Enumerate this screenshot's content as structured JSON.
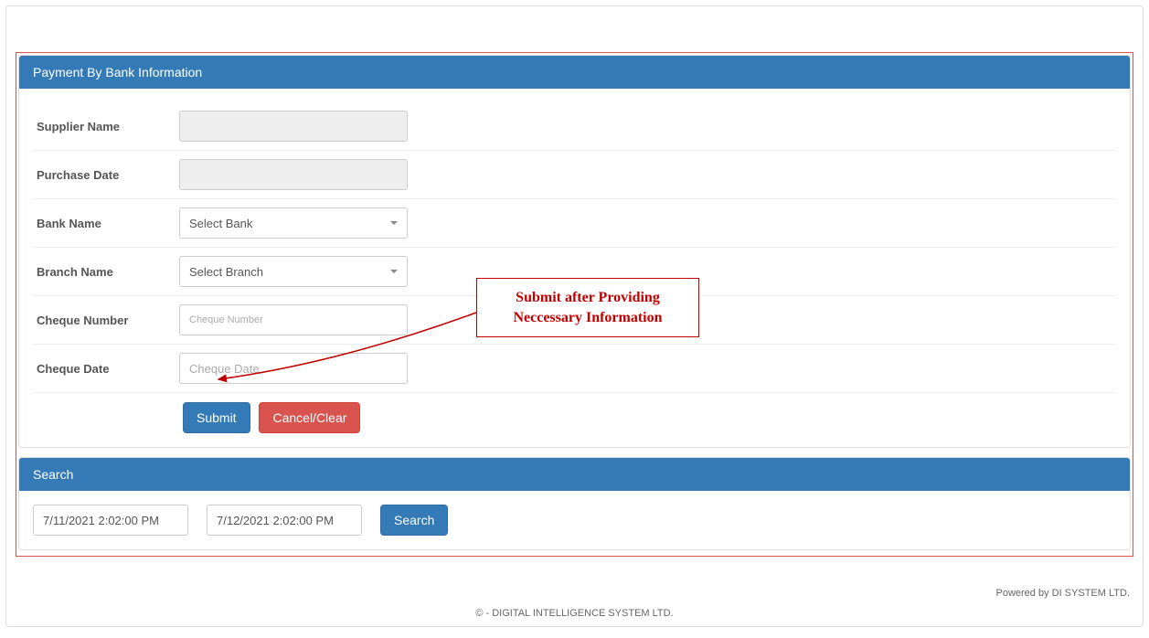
{
  "panel1": {
    "title": "Payment By Bank Information",
    "fields": {
      "supplier_name": {
        "label": "Supplier Name",
        "value": ""
      },
      "purchase_date": {
        "label": "Purchase Date",
        "value": ""
      },
      "bank_name": {
        "label": "Bank Name",
        "selected": "Select Bank"
      },
      "branch_name": {
        "label": "Branch Name",
        "selected": "Select Branch"
      },
      "cheque_number": {
        "label": "Cheque Number",
        "placeholder": "Cheque Number",
        "value": ""
      },
      "cheque_date": {
        "label": "Cheque Date",
        "placeholder": "Cheque Date",
        "value": ""
      }
    },
    "buttons": {
      "submit": "Submit",
      "cancel": "Cancel/Clear"
    }
  },
  "annotation": {
    "text": "Submit after Providing Neccessary Information"
  },
  "panel2": {
    "title": "Search",
    "date_from": "7/11/2021 2:02:00 PM",
    "date_to": "7/12/2021 2:02:00 PM",
    "search_button": "Search"
  },
  "footer": {
    "powered": "Powered by DI SYSTEM LTD.",
    "copyright": "©  - DIGITAL INTELLIGENCE SYSTEM LTD."
  }
}
